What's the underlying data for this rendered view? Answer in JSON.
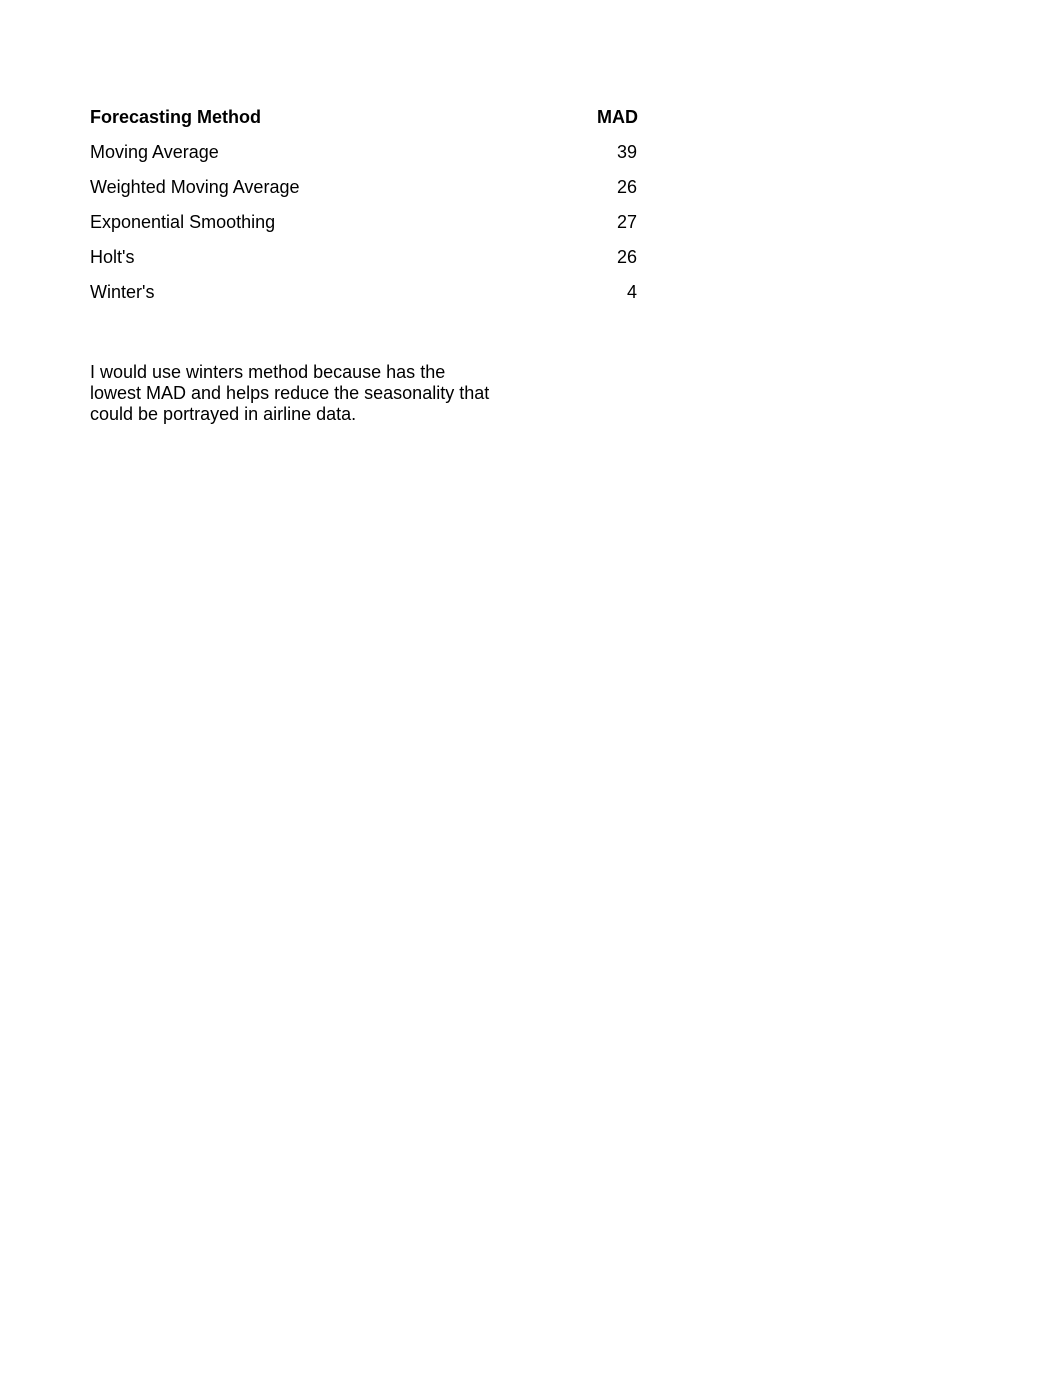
{
  "document": {
    "background_color": "#ffffff",
    "text_color": "#000000"
  },
  "table": {
    "headers": {
      "method": "Forecasting Method",
      "mad": "MAD"
    },
    "rows": [
      {
        "method": "Moving Average",
        "mad": "39"
      },
      {
        "method": "Weighted Moving Average",
        "mad": "26"
      },
      {
        "method": "Exponential Smoothing",
        "mad": "27"
      },
      {
        "method": "Holt's",
        "mad": "26"
      },
      {
        "method": "Winter's",
        "mad": "4"
      }
    ]
  },
  "explanation": {
    "text": "I would use winters method because has the\nlowest MAD and helps reduce the seasonality that\ncould be portrayed in airline data."
  },
  "chart_data": {
    "type": "table",
    "title": "",
    "columns": [
      "Forecasting Method",
      "MAD"
    ],
    "categories": [
      "Moving Average",
      "Weighted Moving Average",
      "Exponential Smoothing",
      "Holt's",
      "Winter's"
    ],
    "values": [
      39,
      26,
      27,
      26,
      4
    ],
    "xlabel": "Forecasting Method",
    "ylabel": "MAD",
    "grid": false,
    "legend": "none"
  }
}
